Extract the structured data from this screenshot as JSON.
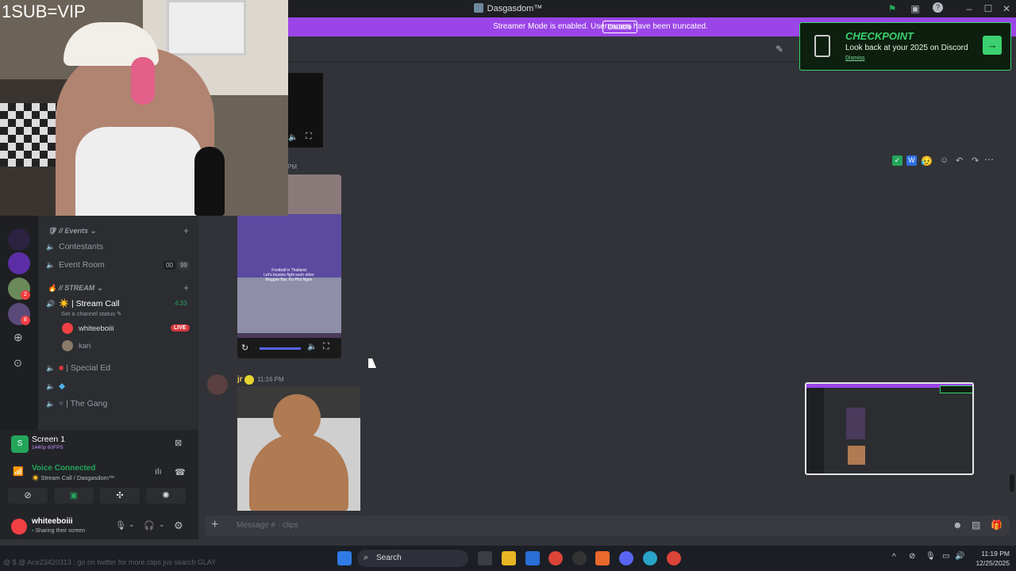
{
  "window": {
    "title": "Dasgasdom™"
  },
  "stream_overlay": {
    "text": "1SUB=VIP"
  },
  "streamer_bar": {
    "text": "Streamer Mode is enabled. Usernames have been truncated.",
    "button": "Disable"
  },
  "checkpoint": {
    "title": "CHECKPOINT",
    "subtitle": "Look back at your 2025 on Discord",
    "dismiss": "Dismiss"
  },
  "servers": {
    "badges": [
      "2",
      "8"
    ]
  },
  "channels": {
    "events_category": "// Events",
    "contestants": "Contestants",
    "event_room": "Event Room",
    "event_room_counts": [
      "00",
      "99"
    ],
    "stream_category": "// STREAM",
    "stream_call": "Stream Call",
    "stream_call_time": "4:33",
    "channel_status": "Set a channel status",
    "user1": "whiteeboiii",
    "live": "LIVE",
    "user2": "kari",
    "special_ed": "Special Ed",
    "gang": "The Gang"
  },
  "screen": {
    "name": "Screen 1",
    "quality": "1440p 60FPS"
  },
  "voice": {
    "status": "Voice Connected",
    "location": "Stream Call / Dasgasdom™"
  },
  "user": {
    "name": "whiteeboiii",
    "status": "Sharing their screen"
  },
  "chat": {
    "timestamp_partial": "PM",
    "msg2_author": "jr",
    "msg2_time": "11:16 PM",
    "video_caption": "Football in Thailand\nLet's tourists fight each other\nReggae Bar, Ko Pha Ngan"
  },
  "composer": {
    "placeholder": "Message # · clips"
  },
  "taskbar": {
    "search": "Search",
    "time": "11:19 PM",
    "date": "12/25/2025",
    "ticker": "@ $ @ Ace23420313 : go on twitter for more clips jus search GLAY"
  }
}
